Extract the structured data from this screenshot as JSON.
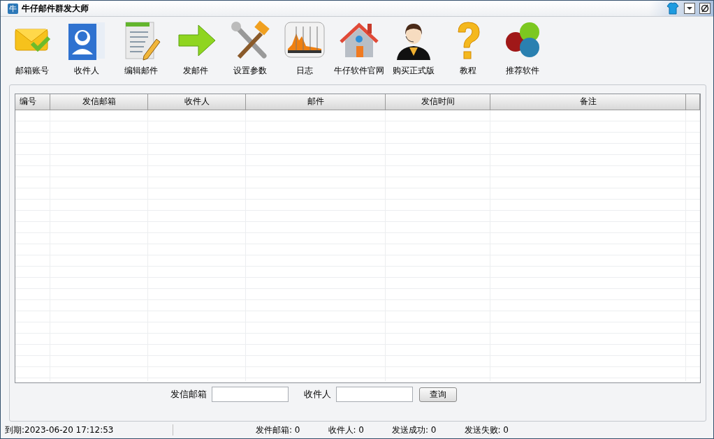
{
  "window": {
    "title": "牛仔邮件群发大师",
    "icon_text": "牛"
  },
  "toolbar": [
    {
      "kind": "mail",
      "label": "邮箱账号"
    },
    {
      "kind": "contacts",
      "label": "收件人"
    },
    {
      "kind": "edit",
      "label": "编辑邮件"
    },
    {
      "kind": "send",
      "label": "发邮件"
    },
    {
      "kind": "tools",
      "label": "设置参数"
    },
    {
      "kind": "log",
      "label": "日志"
    },
    {
      "kind": "home",
      "label": "牛仔软件官网"
    },
    {
      "kind": "agent",
      "label": "购买正式版"
    },
    {
      "kind": "help",
      "label": "教程"
    },
    {
      "kind": "circles",
      "label": "推荐软件"
    }
  ],
  "table": {
    "columns": [
      "编号",
      "发信邮箱",
      "收件人",
      "邮件",
      "发信时间",
      "备注"
    ]
  },
  "search": {
    "sender_label": "发信邮箱",
    "recipient_label": "收件人",
    "button": "查询"
  },
  "status_bar": {
    "expiry": "到期:2023-06-20 17:12:53",
    "counters": [
      "发件邮箱: 0",
      "收件人: 0",
      "发送成功: 0",
      "发送失败: 0"
    ]
  }
}
